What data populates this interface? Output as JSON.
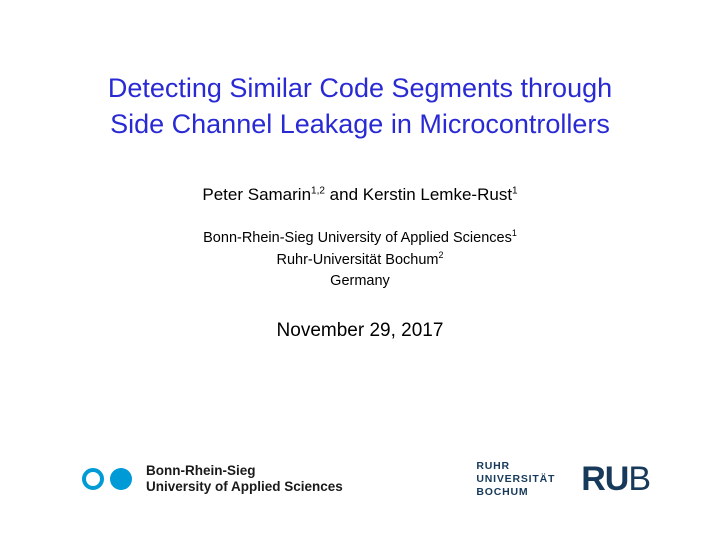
{
  "title": {
    "line1": "Detecting Similar Code Segments through",
    "line2": "Side Channel Leakage in Microcontrollers"
  },
  "authors": {
    "a1_name": "Peter Samarin",
    "a1_sup": "1,2",
    "joiner": " and ",
    "a2_name": "Kerstin Lemke-Rust",
    "a2_sup": "1"
  },
  "affiliations": {
    "l1_text": "Bonn-Rhein-Sieg University of Applied Sciences",
    "l1_sup": "1",
    "l2_text": "Ruhr-Universität Bochum",
    "l2_sup": "2",
    "l3_text": "Germany"
  },
  "date": "November 29, 2017",
  "logo_brs": {
    "line1": "Bonn-Rhein-Sieg",
    "line2": "University of Applied Sciences"
  },
  "logo_rub": {
    "small_l1": "RUHR",
    "small_l2": "UNIVERSITÄT",
    "small_l3": "BOCHUM",
    "big_ru": "RU",
    "big_b": "B"
  }
}
